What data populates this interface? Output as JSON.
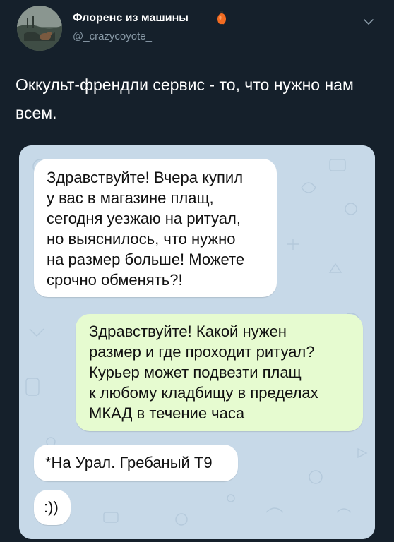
{
  "tweet": {
    "author": {
      "display_name": "Флоренс из машины",
      "handle": "@_crazycoyote_",
      "badge_icon": "lantern-icon",
      "badge_color": "#f26b21"
    },
    "menu_icon": "chevron-down-icon",
    "text": "Оккульт-френдли сервис - то, что нужно нам всем."
  },
  "chat": {
    "messages": [
      {
        "side": "incoming",
        "text": "Здравствуйте! Вчера купил\nу вас в магазине плащ,\nсегодня уезжаю на ритуал,\nно выяснилось, что нужно\nна размер больше! Можете\nсрочно обменять?!"
      },
      {
        "side": "outgoing",
        "text": "Здравствуйте! Какой нужен\nразмер и где проходит ритуал?\nКурьер может подвезти плащ\nк любому кладбищу в пределах\nМКАД в течение часа"
      },
      {
        "side": "incoming",
        "text": "*На Урал. Гребаный Т9"
      },
      {
        "side": "incoming",
        "text": ":))"
      }
    ],
    "colors": {
      "background": "#c7d9e8",
      "incoming_bubble": "#ffffff",
      "outgoing_bubble": "#e6fbd0"
    }
  },
  "theme": {
    "page_background": "#15202b",
    "primary_text": "#ffffff",
    "secondary_text": "#8899a6"
  }
}
